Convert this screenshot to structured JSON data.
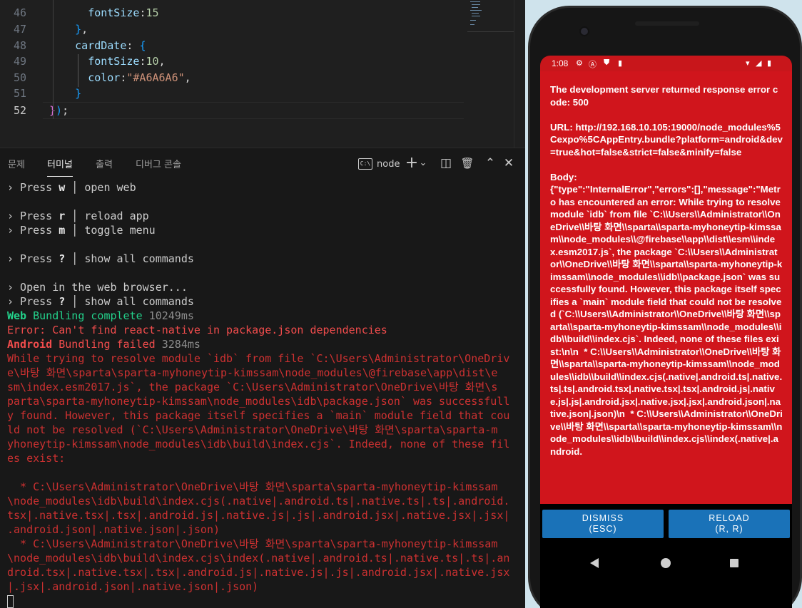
{
  "editor": {
    "lines": [
      {
        "number": "46",
        "segments": [
          {
            "t": "      ",
            "c": "c-pun"
          },
          {
            "t": "fontSize",
            "c": "c-key"
          },
          {
            "t": ":",
            "c": "c-pun"
          },
          {
            "t": "15",
            "c": "c-num"
          }
        ]
      },
      {
        "number": "47",
        "segments": [
          {
            "t": "    ",
            "c": "c-pun"
          },
          {
            "t": "}",
            "c": "c-brk2"
          },
          {
            "t": ",",
            "c": "c-pun"
          }
        ]
      },
      {
        "number": "48",
        "segments": [
          {
            "t": "    ",
            "c": "c-pun"
          },
          {
            "t": "cardDate",
            "c": "c-key"
          },
          {
            "t": ": ",
            "c": "c-pun"
          },
          {
            "t": "{",
            "c": "c-brk2"
          }
        ]
      },
      {
        "number": "49",
        "segments": [
          {
            "t": "      ",
            "c": "c-pun"
          },
          {
            "t": "fontSize",
            "c": "c-key"
          },
          {
            "t": ":",
            "c": "c-pun"
          },
          {
            "t": "10",
            "c": "c-num"
          },
          {
            "t": ",",
            "c": "c-pun"
          }
        ]
      },
      {
        "number": "50",
        "segments": [
          {
            "t": "      ",
            "c": "c-pun"
          },
          {
            "t": "color",
            "c": "c-key"
          },
          {
            "t": ":",
            "c": "c-pun"
          },
          {
            "t": "\"#A6A6A6\"",
            "c": "c-str"
          },
          {
            "t": ",",
            "c": "c-pun"
          }
        ]
      },
      {
        "number": "51",
        "segments": [
          {
            "t": "    ",
            "c": "c-pun"
          },
          {
            "t": "}",
            "c": "c-brk2"
          }
        ]
      },
      {
        "number": "52",
        "segments": [
          {
            "t": "}",
            "c": "c-brk"
          },
          {
            "t": ")",
            "c": "c-brk2"
          },
          {
            "t": ";",
            "c": "c-pun"
          }
        ]
      }
    ],
    "current_line": "52"
  },
  "panel": {
    "tabs": [
      {
        "label": "문제",
        "active": false
      },
      {
        "label": "터미널",
        "active": true
      },
      {
        "label": "출력",
        "active": false
      },
      {
        "label": "디버그 콘솔",
        "active": false
      }
    ],
    "terminal_icon_text": "C:\\",
    "terminal_name": "node",
    "tools": {
      "add": "+",
      "add_menu": "⌄",
      "split": "◫",
      "trash": "🗑",
      "maximize": "⌃",
      "close": "✕"
    }
  },
  "terminal": {
    "lines": [
      [
        {
          "t": "› Press ",
          "c": ""
        },
        {
          "t": "w",
          "c": "t-w"
        },
        {
          "t": " │ open web",
          "c": ""
        }
      ],
      [],
      [
        {
          "t": "› Press ",
          "c": ""
        },
        {
          "t": "r",
          "c": "t-w"
        },
        {
          "t": " │ reload app",
          "c": ""
        }
      ],
      [
        {
          "t": "› Press ",
          "c": ""
        },
        {
          "t": "m",
          "c": "t-w"
        },
        {
          "t": " │ toggle menu",
          "c": ""
        }
      ],
      [],
      [
        {
          "t": "› Press ",
          "c": ""
        },
        {
          "t": "?",
          "c": "t-w"
        },
        {
          "t": " │ show all commands",
          "c": ""
        }
      ],
      [],
      [
        {
          "t": "› Open in the web browser...",
          "c": ""
        }
      ],
      [
        {
          "t": "› Press ",
          "c": ""
        },
        {
          "t": "?",
          "c": "t-w"
        },
        {
          "t": " │ show all commands",
          "c": ""
        }
      ],
      [
        {
          "t": "Web",
          "c": "t-grnb"
        },
        {
          "t": " Bundling complete ",
          "c": "t-grn"
        },
        {
          "t": "10249ms",
          "c": "t-gry"
        }
      ],
      [
        {
          "t": "Error: Can't find react-native in package.json dependencies",
          "c": "t-err"
        }
      ],
      [
        {
          "t": "Android",
          "c": "t-redb"
        },
        {
          "t": " Bundling failed ",
          "c": "t-err"
        },
        {
          "t": "3284ms",
          "c": "t-gry"
        }
      ],
      [
        {
          "t": "While trying to resolve module `idb` from file `C:\\Users\\Administrator\\OneDriv",
          "c": "t-red"
        }
      ],
      [
        {
          "t": "e\\바탕 화면\\sparta\\sparta-myhoneytip-kimssam\\node_modules\\@firebase\\app\\dist\\e",
          "c": "t-red"
        }
      ],
      [
        {
          "t": "sm\\index.esm2017.js`, the package `C:\\Users\\Administrator\\OneDrive\\바탕 화면\\s",
          "c": "t-red"
        }
      ],
      [
        {
          "t": "parta\\sparta-myhoneytip-kimssam\\node_modules\\idb\\package.json` was successfull",
          "c": "t-red"
        }
      ],
      [
        {
          "t": "y found. However, this package itself specifies a `main` module field that cou",
          "c": "t-red"
        }
      ],
      [
        {
          "t": "ld not be resolved (`C:\\Users\\Administrator\\OneDrive\\바탕 화면\\sparta\\sparta-m",
          "c": "t-red"
        }
      ],
      [
        {
          "t": "yhoneytip-kimssam\\node_modules\\idb\\build\\index.cjs`. Indeed, none of these fil",
          "c": "t-red"
        }
      ],
      [
        {
          "t": "es exist:",
          "c": "t-red"
        }
      ],
      [],
      [
        {
          "t": "  * C:\\Users\\Administrator\\OneDrive\\바탕 화면\\sparta\\sparta-myhoneytip-kimssam",
          "c": "t-red"
        }
      ],
      [
        {
          "t": "\\node_modules\\idb\\build\\index.cjs(.native|.android.ts|.native.ts|.ts|.android.",
          "c": "t-red"
        }
      ],
      [
        {
          "t": "tsx|.native.tsx|.tsx|.android.js|.native.js|.js|.android.jsx|.native.jsx|.jsx|",
          "c": "t-red"
        }
      ],
      [
        {
          "t": ".android.json|.native.json|.json)",
          "c": "t-red"
        }
      ],
      [
        {
          "t": "  * C:\\Users\\Administrator\\OneDrive\\바탕 화면\\sparta\\sparta-myhoneytip-kimssam",
          "c": "t-red"
        }
      ],
      [
        {
          "t": "\\node_modules\\idb\\build\\index.cjs\\index(.native|.android.ts|.native.ts|.ts|.an",
          "c": "t-red"
        }
      ],
      [
        {
          "t": "droid.tsx|.native.tsx|.tsx|.android.js|.native.js|.js|.android.jsx|.native.jsx",
          "c": "t-red"
        }
      ],
      [
        {
          "t": "|.jsx|.android.json|.native.json|.json)",
          "c": "t-red"
        }
      ]
    ]
  },
  "phone": {
    "status_time": "1:08",
    "status_icons_left": [
      "⚙",
      "Ⓐ",
      "⛊",
      "▮"
    ],
    "status_icons_right": [
      "▾",
      "◢",
      "▮"
    ],
    "error_text": "The development server returned response error code: 500\n\nURL: http://192.168.10.105:19000/node_modules%5Cexpo%5CAppEntry.bundle?platform=android&dev=true&hot=false&strict=false&minify=false\n\nBody:\n{\"type\":\"InternalError\",\"errors\":[],\"message\":\"Metro has encountered an error: While trying to resolve module `idb` from file `C:\\\\Users\\\\Administrator\\\\OneDrive\\\\바탕 화면\\\\sparta\\\\sparta-myhoneytip-kimssam\\\\node_modules\\\\@firebase\\\\app\\\\dist\\\\esm\\\\index.esm2017.js`, the package `C:\\\\Users\\\\Administrator\\\\OneDrive\\\\바탕 화면\\\\sparta\\\\sparta-myhoneytip-kimssam\\\\node_modules\\\\idb\\\\package.json` was successfully found. However, this package itself specifies a `main` module field that could not be resolved (`C:\\\\Users\\\\Administrator\\\\OneDrive\\\\바탕 화면\\\\sparta\\\\sparta-myhoneytip-kimssam\\\\node_modules\\\\idb\\\\build\\\\index.cjs`. Indeed, none of these files exist:\\n\\n  * C:\\\\Users\\\\Administrator\\\\OneDrive\\\\바탕 화면\\\\sparta\\\\sparta-myhoneytip-kimssam\\\\node_modules\\\\idb\\\\build\\\\index.cjs(.native|.android.ts|.native.ts|.ts|.android.tsx|.native.tsx|.tsx|.android.js|.native.js|.js|.android.jsx|.native.jsx|.jsx|.android.json|.native.json|.json)\\n  * C:\\\\Users\\\\Administrator\\\\OneDrive\\\\바탕 화면\\\\sparta\\\\sparta-myhoneytip-kimssam\\\\node_modules\\\\idb\\\\build\\\\index.cjs\\\\index(.native|.android.",
    "dismiss_label": "DISMISS",
    "dismiss_shortcut": "(ESC)",
    "reload_label": "RELOAD",
    "reload_shortcut": "(R, R)"
  },
  "colors": {
    "error_red": "#d0151c",
    "button_blue": "#1a72b8",
    "editor_bg": "#1f1f1f",
    "terminal_bg": "#181818"
  }
}
